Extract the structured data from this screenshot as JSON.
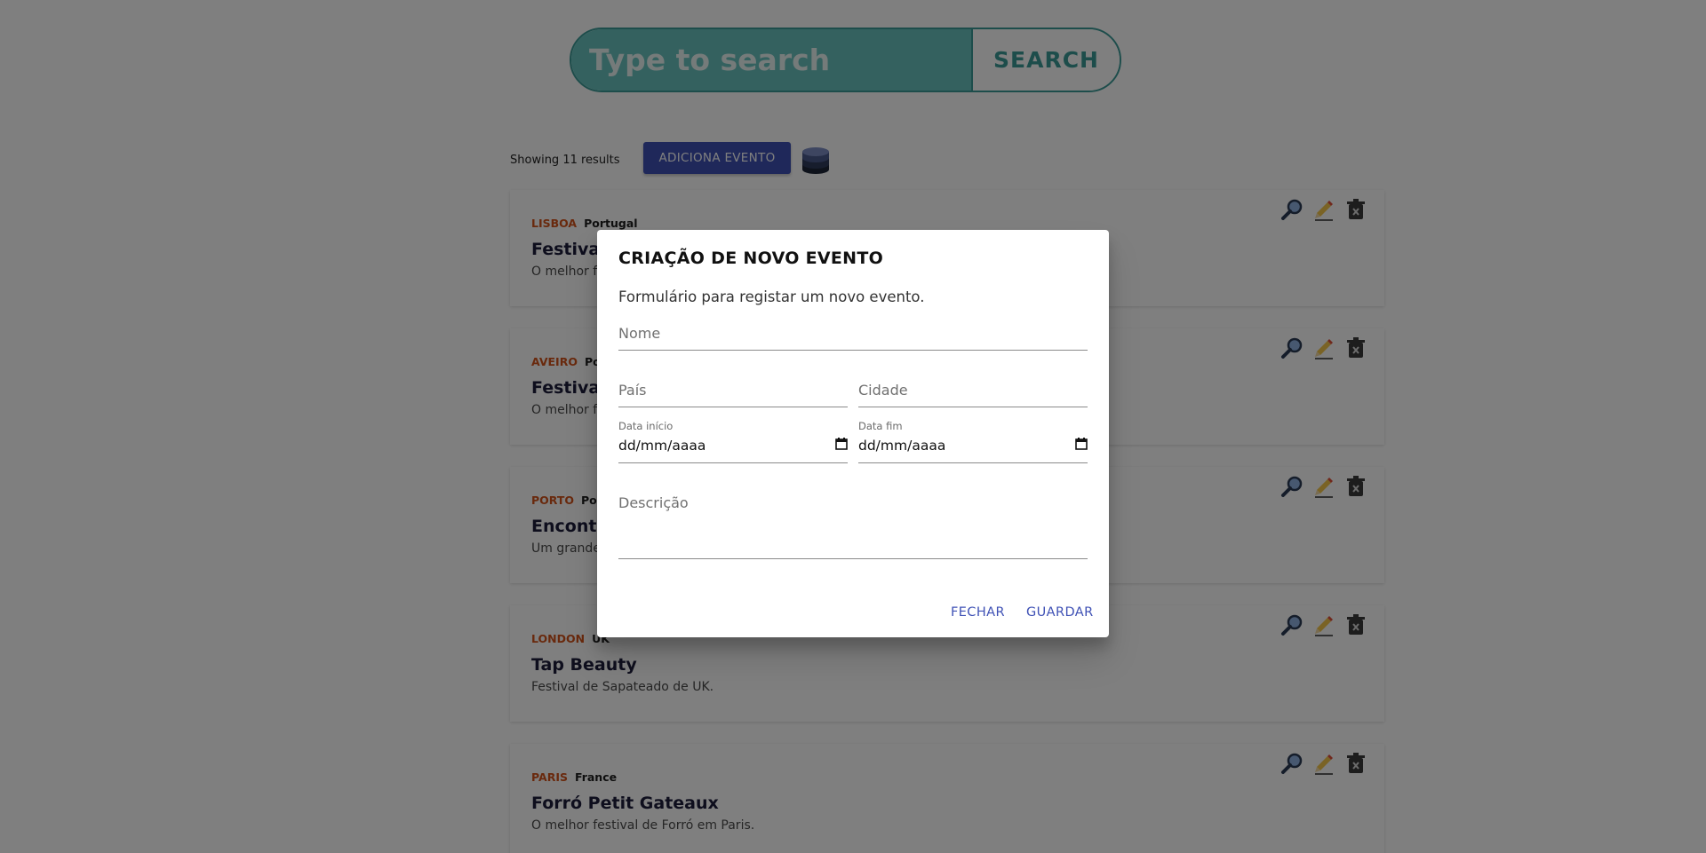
{
  "search": {
    "placeholder": "Type to search",
    "button_label": "SEARCH"
  },
  "toolbar": {
    "results_text": "Showing 11 results",
    "add_button_label": "ADICIONA EVENTO",
    "database_icon": "database-icon"
  },
  "events": [
    {
      "city": "LISBOA",
      "country": "Portugal",
      "title": "Festival",
      "description": "O melhor f"
    },
    {
      "city": "AVEIRO",
      "country": "Po",
      "title": "Festival",
      "description": "O melhor f"
    },
    {
      "city": "PORTO",
      "country": "Por",
      "title": "Encontr",
      "description": "Um grande"
    },
    {
      "city": "LONDON",
      "country": "UK",
      "title": "Tap Beauty",
      "description": "Festival de Sapateado de UK."
    },
    {
      "city": "PARIS",
      "country": "France",
      "title": "Forró Petit Gateaux",
      "description": "O melhor festival de Forró em Paris."
    }
  ],
  "card_actions": [
    "view-icon",
    "edit-icon",
    "delete-icon"
  ],
  "dialog": {
    "title": "CRIAÇÃO DE NOVO EVENTO",
    "subtitle": "Formulário para registar um novo evento.",
    "name_placeholder": "Nome",
    "country_placeholder": "País",
    "city_placeholder": "Cidade",
    "start_label": "Data início",
    "start_value": "dd/mm/aaaa",
    "end_label": "Data fim",
    "end_value": "dd/mm/aaaa",
    "description_placeholder": "Descrição",
    "close_label": "FECHAR",
    "save_label": "GUARDAR"
  },
  "colors": {
    "accent": "#3f51b5",
    "search_fill": "#68c2be",
    "search_border": "#3a9a97",
    "city": "#d3531a"
  }
}
